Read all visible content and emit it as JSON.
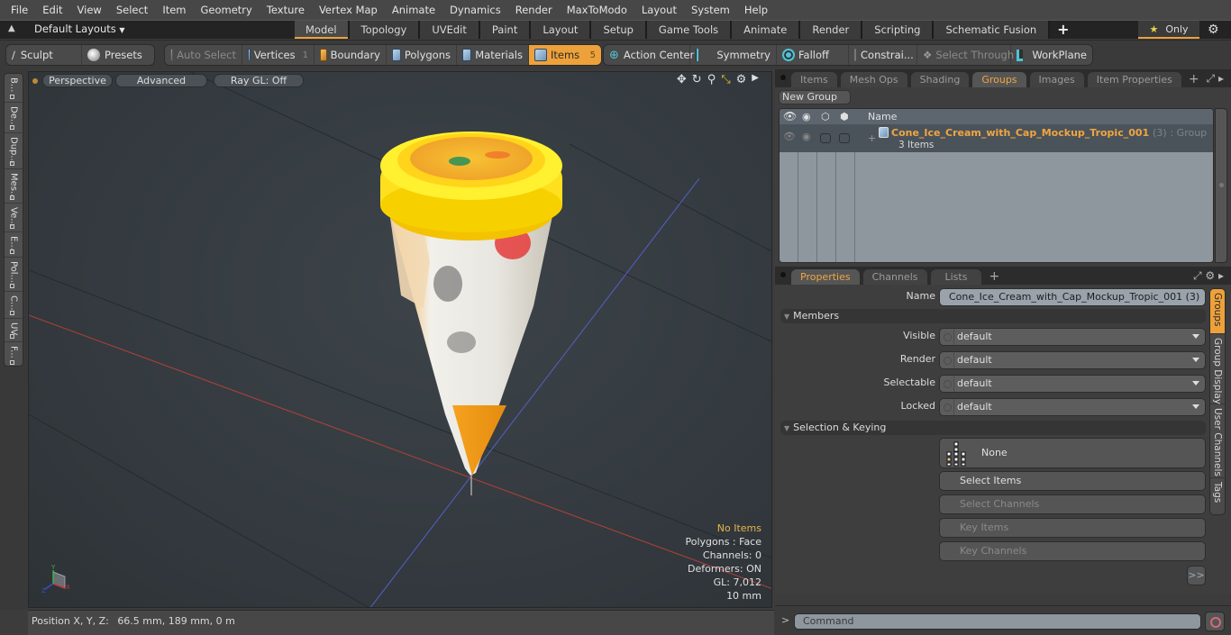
{
  "menubar": {
    "items": [
      "File",
      "Edit",
      "View",
      "Select",
      "Item",
      "Geometry",
      "Texture",
      "Vertex Map",
      "Animate",
      "Dynamics",
      "Render",
      "MaxToModo",
      "Layout",
      "System",
      "Help"
    ]
  },
  "layoutbar": {
    "layout_selector": "Default Layouts",
    "tabs": [
      {
        "label": "Model",
        "active": true
      },
      {
        "label": "Topology"
      },
      {
        "label": "UVEdit"
      },
      {
        "label": "Paint"
      },
      {
        "label": "Layout"
      },
      {
        "label": "Setup"
      },
      {
        "label": "Game Tools"
      },
      {
        "label": "Animate"
      },
      {
        "label": "Render"
      },
      {
        "label": "Scripting"
      },
      {
        "label": "Schematic Fusion"
      }
    ],
    "add_tab": "+",
    "only_label": "Only"
  },
  "toolbar": {
    "sculpt": "Sculpt",
    "presets": "Presets",
    "auto_select": "Auto Select",
    "vertices": "Vertices",
    "vertices_count": "1",
    "boundary": "Boundary",
    "polygons": "Polygons",
    "materials": "Materials",
    "items": "Items",
    "items_count": "5",
    "action_center": "Action Center",
    "symmetry": "Symmetry",
    "falloff": "Falloff",
    "constraints": "Constrai...",
    "select_through": "Select Through",
    "workplane": "WorkPlane"
  },
  "left_tabs": [
    "B...",
    "De...",
    "Dup...",
    "Mes...",
    "Ve...",
    "E...",
    "Pol...",
    "C...",
    "UV",
    "F..."
  ],
  "viewport": {
    "perspective": "Perspective",
    "advanced": "Advanced",
    "raygl": "Ray GL: Off",
    "info": {
      "selection": "No Items",
      "polygons": "Polygons : Face",
      "channels": "Channels: 0",
      "deformers": "Deformers: ON",
      "gl": "GL: 7,012",
      "scale": "10 mm"
    },
    "accent_color": "#e8b54a"
  },
  "statusbar": {
    "label": "Position X, Y, Z:",
    "value": "66.5 mm, 189 mm, 0 m"
  },
  "top_panel": {
    "tabs": [
      {
        "label": "Items"
      },
      {
        "label": "Mesh Ops"
      },
      {
        "label": "Shading"
      },
      {
        "label": "Groups",
        "active": true
      },
      {
        "label": "Images"
      },
      {
        "label": "Item Properties"
      }
    ],
    "add_tab": "+",
    "new_group": "New Group",
    "column_name": "Name",
    "group": {
      "name": "Cone_Ice_Cream_with_Cap_Mockup_Tropic_001",
      "count": "(3)",
      "type": ": Group",
      "items": "3 Items"
    }
  },
  "bottom_panel": {
    "tabs": [
      {
        "label": "Properties",
        "active": true
      },
      {
        "label": "Channels"
      },
      {
        "label": "Lists"
      }
    ],
    "add_tab": "+",
    "name_label": "Name",
    "name_value": "Cone_Ice_Cream_with_Cap_Mockup_Tropic_001 (3)",
    "members_section": "Members",
    "members": [
      {
        "label": "Visible",
        "value": "default"
      },
      {
        "label": "Render",
        "value": "default"
      },
      {
        "label": "Selectable",
        "value": "default"
      },
      {
        "label": "Locked",
        "value": "default"
      }
    ],
    "selection_section": "Selection & Keying",
    "hierarchy_value": "None",
    "buttons": [
      {
        "label": "Select Items",
        "enabled": true
      },
      {
        "label": "Select Channels",
        "enabled": false
      },
      {
        "label": "Key Items",
        "enabled": false
      },
      {
        "label": "Key Channels",
        "enabled": false
      }
    ],
    "more": ">>",
    "side_tabs": [
      {
        "label": "Groups",
        "active": true
      },
      {
        "label": "Group Display"
      },
      {
        "label": "User Channels"
      },
      {
        "label": "Tags"
      }
    ]
  },
  "command": {
    "prompt": ">",
    "placeholder": "Command"
  },
  "colors": {
    "accent": "#eda13a",
    "tab_active_text": "#f0a640"
  }
}
